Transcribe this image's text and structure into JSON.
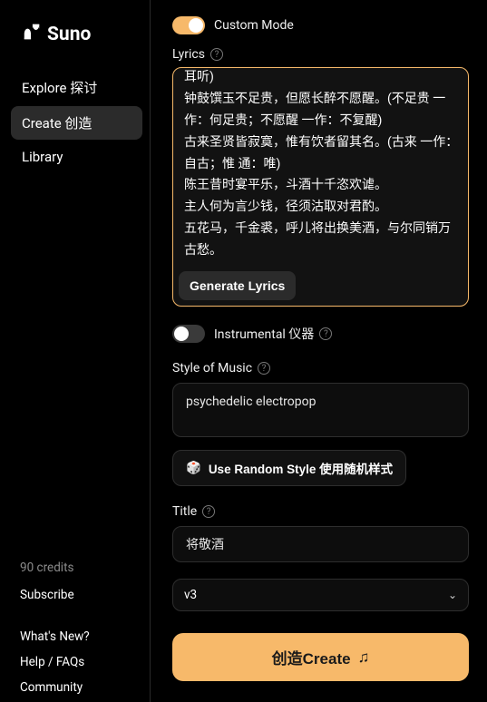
{
  "brand": "Suno",
  "nav": {
    "explore": "Explore 探讨",
    "create": "Create 创造",
    "library": "Library"
  },
  "sidebar_bottom": {
    "credits": "90 credits",
    "subscribe": "Subscribe",
    "whats_new": "What's New?",
    "help": "Help / FAQs",
    "community": "Community"
  },
  "custom_mode": {
    "label": "Custom Mode",
    "on": true
  },
  "lyrics": {
    "label": "Lyrics",
    "value": "\n岑夫子，丹丘生，将进酒，杯莫停。\n与君歌一曲，请君为我倾耳听。(倾耳听 一作：侧耳听)\n钟鼓馔玉不足贵，但愿长醉不愿醒。(不足贵 一作：何足贵；不愿醒 一作：不复醒)\n古来圣贤皆寂寞，惟有饮者留其名。(古来 一作：自古；惟 通：唯)\n陈王昔时宴平乐，斗酒十千恣欢谑。\n主人何为言少钱，径须沽取对君酌。\n五花马，千金裘，呼儿将出换美酒，与尔同销万古愁。",
    "generate_btn": "Generate Lyrics"
  },
  "instrumental": {
    "label": "Instrumental 仪器",
    "on": false
  },
  "style": {
    "label": "Style of Music",
    "value": "psychedelic electropop",
    "random_btn": "Use Random Style 使用随机样式"
  },
  "title": {
    "label": "Title",
    "value": "将敬酒"
  },
  "version": {
    "selected": "v3"
  },
  "create_btn": "创造Create",
  "icons": {
    "help": "?",
    "music_note": "♫",
    "dice": "🎲",
    "chevron_down": "⌄"
  }
}
